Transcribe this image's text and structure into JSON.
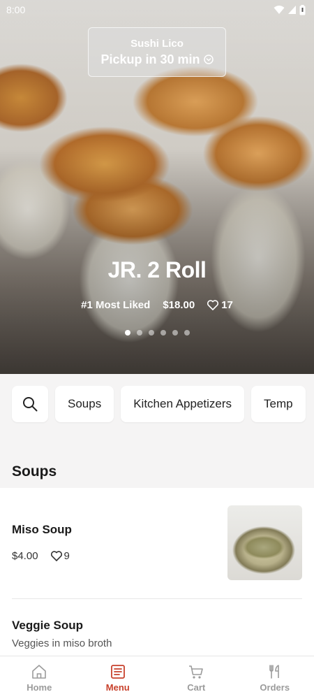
{
  "status_bar": {
    "time": "8:00"
  },
  "pickup": {
    "store_name": "Sushi Lico",
    "pickup_label": "Pickup in 30 min"
  },
  "hero": {
    "title": "JR. 2 Roll",
    "badge": "#1 Most Liked",
    "price": "$18.00",
    "likes": "17",
    "carousel": {
      "count": 6,
      "active_index": 0
    }
  },
  "categories": [
    "Soups",
    "Kitchen Appetizers",
    "Temp"
  ],
  "section": {
    "title": "Soups"
  },
  "items": [
    {
      "name": "Miso Soup",
      "price": "$4.00",
      "likes": "9"
    },
    {
      "name": "Veggie Soup",
      "description": "Veggies in miso broth"
    }
  ],
  "nav": [
    {
      "label": "Home",
      "icon": "home-icon",
      "active": false
    },
    {
      "label": "Menu",
      "icon": "menu-icon",
      "active": true
    },
    {
      "label": "Cart",
      "icon": "cart-icon",
      "active": false
    },
    {
      "label": "Orders",
      "icon": "orders-icon",
      "active": false
    }
  ],
  "colors": {
    "accent": "#c8412c",
    "inactive": "#9b9b9b",
    "category_bg": "#f5f4f4"
  }
}
